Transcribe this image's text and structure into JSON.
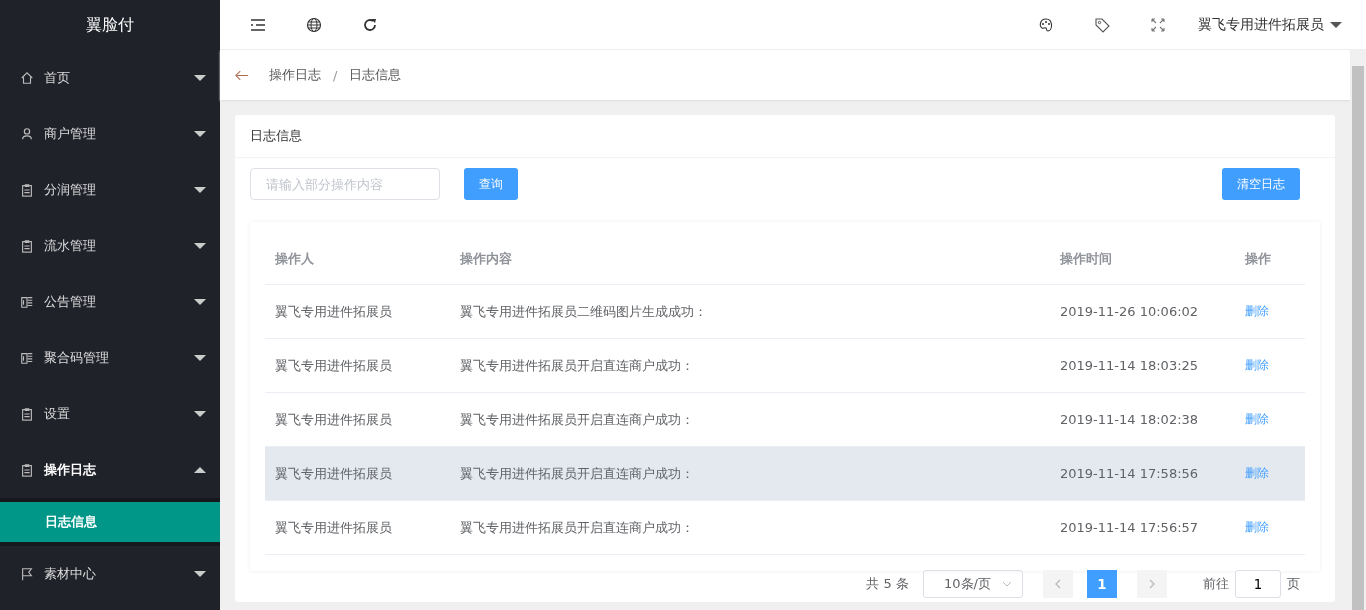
{
  "sidebar": {
    "logo": "翼脸付",
    "items": [
      {
        "label": "首页",
        "kind": "home",
        "expanded": false
      },
      {
        "label": "商户管理",
        "kind": "user",
        "expanded": false
      },
      {
        "label": "分润管理",
        "kind": "clipboard",
        "expanded": false
      },
      {
        "label": "流水管理",
        "kind": "clipboard",
        "expanded": false
      },
      {
        "label": "公告管理",
        "kind": "book",
        "expanded": false
      },
      {
        "label": "聚合码管理",
        "kind": "book",
        "expanded": false
      },
      {
        "label": "设置",
        "kind": "clipboard",
        "expanded": false
      },
      {
        "label": "操作日志",
        "kind": "clipboard",
        "expanded": true,
        "children": [
          {
            "label": "日志信息",
            "selected": true
          }
        ]
      },
      {
        "label": "素材中心",
        "kind": "flag",
        "expanded": false
      }
    ]
  },
  "header": {
    "user": "翼飞专用进件拓展员"
  },
  "breadcrumb": {
    "items": [
      "操作日志",
      "日志信息"
    ],
    "separator": "/"
  },
  "card": {
    "title": "日志信息",
    "search": {
      "placeholder": "请输入部分操作内容"
    },
    "search_button": "查询",
    "clear_button": "清空日志"
  },
  "table": {
    "columns": [
      "操作人",
      "操作内容",
      "操作时间",
      "操作"
    ],
    "rows": [
      {
        "operator": "翼飞专用进件拓展员",
        "content": "翼飞专用进件拓展员二维码图片生成成功：",
        "time": "2019-11-26 10:06:02",
        "action": "删除",
        "hovered": false
      },
      {
        "operator": "翼飞专用进件拓展员",
        "content": "翼飞专用进件拓展员开启直连商户成功：",
        "time": "2019-11-14 18:03:25",
        "action": "删除",
        "hovered": false
      },
      {
        "operator": "翼飞专用进件拓展员",
        "content": "翼飞专用进件拓展员开启直连商户成功：",
        "time": "2019-11-14 18:02:38",
        "action": "删除",
        "hovered": false
      },
      {
        "operator": "翼飞专用进件拓展员",
        "content": "翼飞专用进件拓展员开启直连商户成功：",
        "time": "2019-11-14 17:58:56",
        "action": "删除",
        "hovered": true
      },
      {
        "operator": "翼飞专用进件拓展员",
        "content": "翼飞专用进件拓展员开启直连商户成功：",
        "time": "2019-11-14 17:56:57",
        "action": "删除",
        "hovered": false
      }
    ]
  },
  "pagination": {
    "total": "共 5 条",
    "page_size": "10条/页",
    "pages": [
      {
        "label": "1",
        "selected": true
      }
    ],
    "goto_label": "前往",
    "goto_value": "1",
    "goto_suffix": "页"
  }
}
